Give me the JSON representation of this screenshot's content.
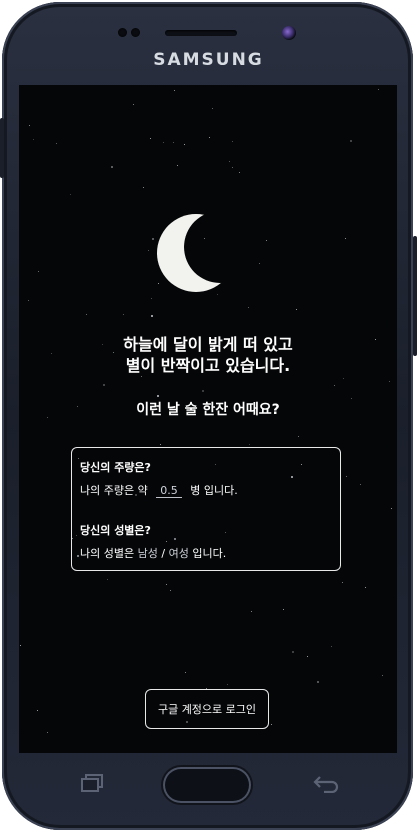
{
  "device": {
    "brand": "SAMSUNG"
  },
  "screen": {
    "headline_line1": "하늘에 달이 밝게 떠 있고",
    "headline_line2": "별이 반짝이고 있습니다.",
    "question": "이런 날 술 한잔 어때요?",
    "card": {
      "drink_label": "당신의 주량은?",
      "drink_prefix": "나의 주량은 약",
      "drink_value": "0.5",
      "drink_suffix": "병 입니다.",
      "gender_label": "당신의 성별은?",
      "gender_prefix": "나의 성별은",
      "gender_male": "남성",
      "gender_sep": "/",
      "gender_female": "여성",
      "gender_suffix": "입니다."
    },
    "login_button": "구글 계정으로 로그인"
  },
  "nav": {
    "recent_icon": "recent-apps-icon",
    "home_icon": "home-button",
    "back_icon": "back-icon"
  },
  "colors": {
    "screen_bg": "#050608",
    "text": "#ffffff",
    "moon": "#f2f2ee"
  }
}
